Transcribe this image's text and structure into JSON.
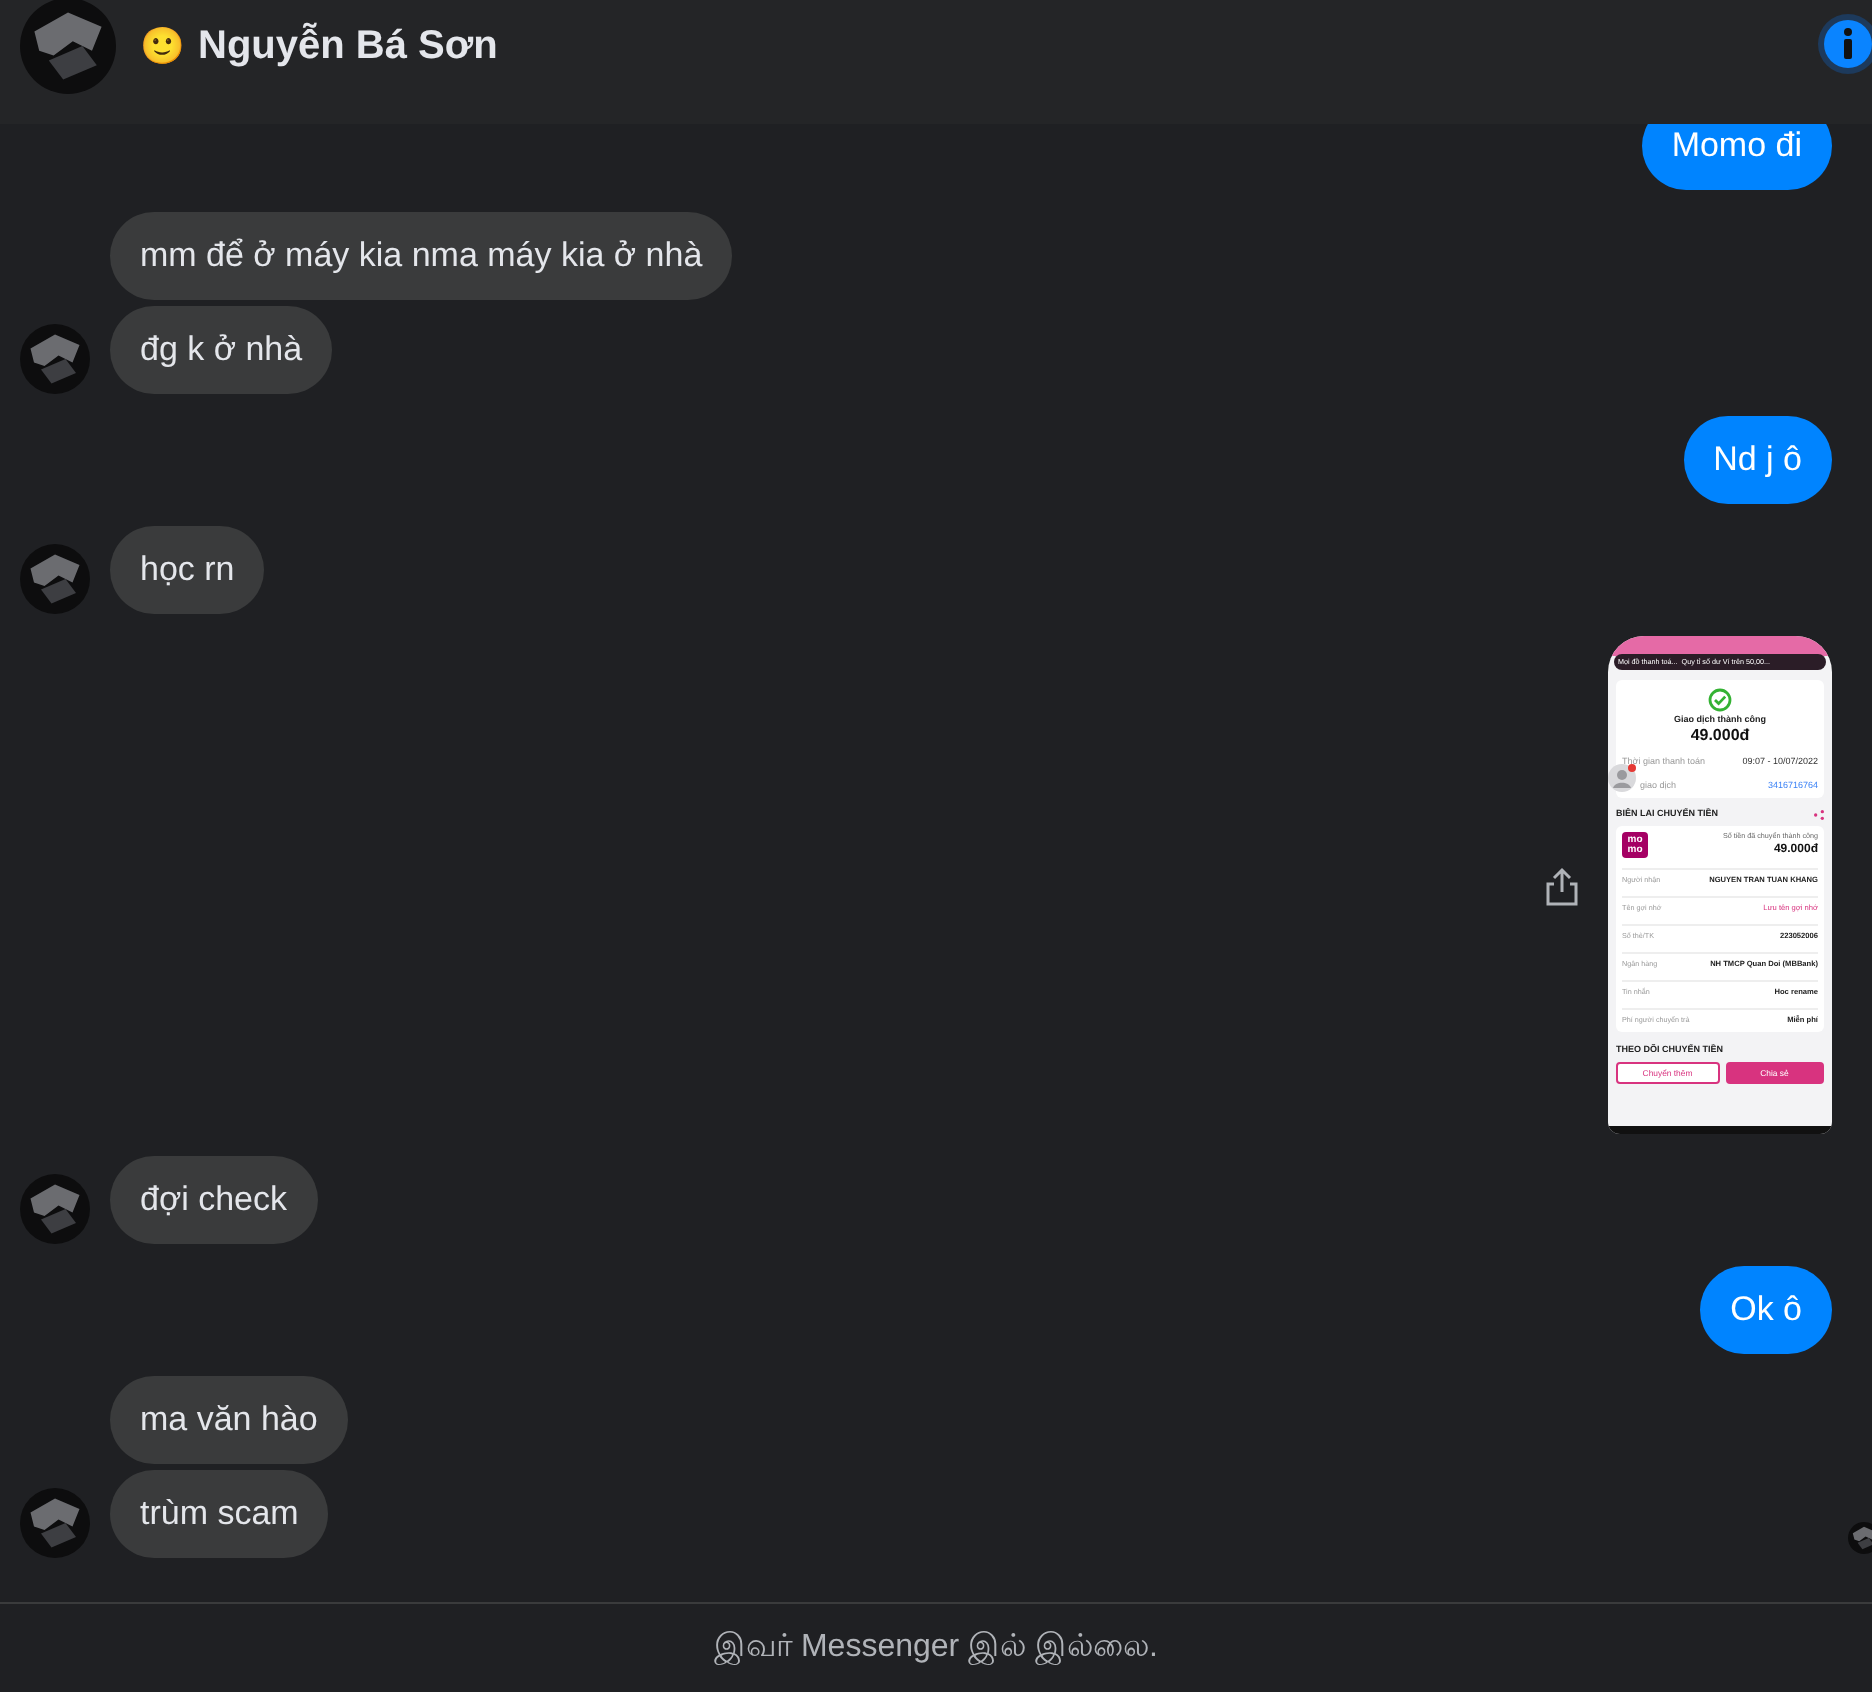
{
  "header": {
    "emoji": "🙂",
    "name": "Nguyễn Bá Sơn"
  },
  "messages": [
    {
      "kind": "text",
      "outgoing": true,
      "text": "Momo đi"
    },
    {
      "kind": "text",
      "outgoing": false,
      "avatar": false,
      "text": "mm để ở máy kia nma máy kia ở nhà"
    },
    {
      "kind": "text",
      "outgoing": false,
      "avatar": true,
      "text": "đg k ở nhà"
    },
    {
      "kind": "text",
      "outgoing": true,
      "text": "Nd j ô"
    },
    {
      "kind": "text",
      "outgoing": false,
      "avatar": true,
      "text": "học rn"
    },
    {
      "kind": "image",
      "outgoing": true,
      "receipt": {
        "notice_title": "Mọi đồ thanh toá...",
        "notice_text": "Quy tỉ số dư Ví trên 50,00...",
        "status": "Giao dịch thành công",
        "amount": "49.000đ",
        "time_label": "Thời gian thanh toán",
        "time_value": "09:07 - 10/07/2022",
        "code_label": "giao dịch",
        "code_value": "3416716764",
        "section": "BIÊN LAI CHUYỂN TIỀN",
        "logo": [
          "mo",
          "mo"
        ],
        "sent_label": "Số tiền đã chuyển thành công",
        "sent_amount": "49.000đ",
        "rows": [
          {
            "label": "Người nhận",
            "value": "NGUYEN TRAN TUAN KHANG",
            "kind": "plain"
          },
          {
            "label": "Tên gợi nhớ",
            "value": "Lưu tên gợi nhớ",
            "kind": "link"
          },
          {
            "label": "Số thẻ/TK",
            "value": "223052006",
            "kind": "plain"
          },
          {
            "label": "Ngân hàng",
            "value": "NH TMCP Quan Doi (MBBank)",
            "kind": "plain"
          },
          {
            "label": "Tin nhắn",
            "value": "Hoc rename",
            "kind": "plain"
          },
          {
            "label": "Phí người chuyển trả",
            "value": "Miễn phí",
            "kind": "plain"
          }
        ],
        "follow": "THEO DÕI CHUYỂN TIỀN",
        "buttons": [
          "Chuyển thêm",
          "Chia sẻ"
        ]
      }
    },
    {
      "kind": "text",
      "outgoing": false,
      "avatar": true,
      "text": "đợi check"
    },
    {
      "kind": "text",
      "outgoing": true,
      "text": "Ok ô"
    },
    {
      "kind": "text",
      "outgoing": false,
      "avatar": false,
      "text": "ma văn hào"
    },
    {
      "kind": "text",
      "outgoing": false,
      "avatar": true,
      "text": "trùm scam"
    }
  ],
  "footer": "இவர் Messenger இல் இல்லை."
}
